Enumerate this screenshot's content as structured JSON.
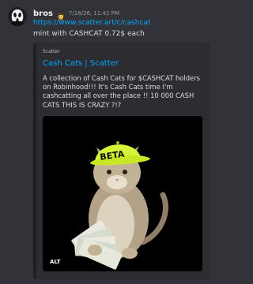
{
  "message": {
    "author": "bros",
    "badge_icon": "person-hat-emoji",
    "timestamp": "7/16/26, 11:42 PM",
    "link": "https://www.scatter.art/c/cashcat",
    "text": "mint with CASHCAT 0.72$ each"
  },
  "embed": {
    "provider": "Scatter",
    "title": "Cash Cats | Scatter",
    "description": "A collection of Cash Cats for $CASHCAT holders on Robinhood!!! It's Cash Cats time I'm cashcatting all over the place !! 10 000 CASH CATS THIS IS CRAZY ?!?",
    "image": {
      "subject": "cat-wearing-neon-cap-holding-cash",
      "cap_text": "BETA",
      "alt_label": "ALT"
    }
  },
  "colors": {
    "background": "#313338",
    "embed_background": "#2b2d31",
    "link": "#00a8fc",
    "neon_cap": "#d8f43a"
  }
}
